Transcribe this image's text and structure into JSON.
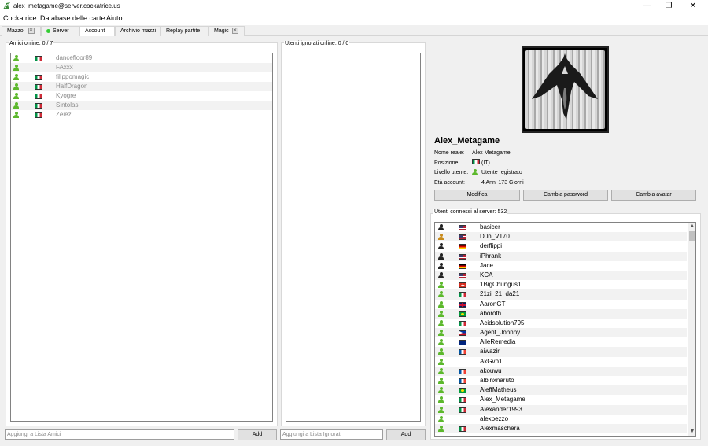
{
  "window": {
    "title": "alex_metagame@server.cockatrice.us",
    "minimize": "—",
    "maximize": "❐",
    "close": "✕"
  },
  "menu": [
    "Cockatrice",
    "Database delle carte",
    "Aiuto"
  ],
  "tabs": [
    {
      "label": "Mazzo:",
      "closable": true
    },
    {
      "label": "Server",
      "status": "online"
    },
    {
      "label": "Account",
      "active": true
    },
    {
      "label": "Archivio mazzi"
    },
    {
      "label": "Replay partite"
    },
    {
      "label": "Magic",
      "closable": true
    }
  ],
  "friends": {
    "header": "Amici online: 0 / 7",
    "items": [
      {
        "name": "dancefloor89",
        "flag": "it"
      },
      {
        "name": "FAxxx",
        "flag": "none"
      },
      {
        "name": "filippomagic",
        "flag": "it"
      },
      {
        "name": "HalfDragon",
        "flag": "it"
      },
      {
        "name": "Kyogre",
        "flag": "it"
      },
      {
        "name": "Sintolas",
        "flag": "it"
      },
      {
        "name": "Zeiez",
        "flag": "it"
      }
    ],
    "add_placeholder": "Aggiungi a Lista Amici",
    "add_button": "Add"
  },
  "ignored": {
    "header": "Utenti ignorati online: 0 / 0",
    "add_placeholder": "Aggiungi a Lista Ignorati",
    "add_button": "Add"
  },
  "profile": {
    "username": "Alex_Metagame",
    "real_name_label": "Nome reale:",
    "real_name": "Alex Metagame",
    "location_label": "Posizione:",
    "location": "(IT)",
    "level_label": "Livello utente:",
    "level": "Utente registrato",
    "age_label": "Età account:",
    "age": "4 Anni 173 Giorni",
    "buttons": {
      "edit": "Modifica",
      "change_password": "Cambia password",
      "change_avatar": "Cambia avatar"
    }
  },
  "online_users": {
    "header": "Utenti connessi al server: 532",
    "items": [
      {
        "name": "basicer",
        "flag": "us",
        "role": "dark"
      },
      {
        "name": "D0n_V170",
        "flag": "us",
        "role": "gold"
      },
      {
        "name": "derflippi",
        "flag": "de",
        "role": "dark"
      },
      {
        "name": "iPhrank",
        "flag": "us",
        "role": "dark"
      },
      {
        "name": "Jace",
        "flag": "de",
        "role": "dark"
      },
      {
        "name": "KCA",
        "flag": "us",
        "role": "dark"
      },
      {
        "name": "1BigChungus1",
        "flag": "ch",
        "role": "green"
      },
      {
        "name": "21zi_21_da21",
        "flag": "it",
        "role": "green"
      },
      {
        "name": "AaronGT",
        "flag": "gb",
        "role": "green"
      },
      {
        "name": "aboroth",
        "flag": "br",
        "role": "green"
      },
      {
        "name": "Acidsolution795",
        "flag": "it",
        "role": "green"
      },
      {
        "name": "Agent_Johnny",
        "flag": "ph",
        "role": "green"
      },
      {
        "name": "AileRemedia",
        "flag": "au",
        "role": "green"
      },
      {
        "name": "aiwazir",
        "flag": "fr",
        "role": "green"
      },
      {
        "name": "AkGvp1",
        "flag": "none",
        "role": "green"
      },
      {
        "name": "akouwu",
        "flag": "fr",
        "role": "green"
      },
      {
        "name": "albinxnaruto",
        "flag": "fr",
        "role": "green"
      },
      {
        "name": "AleffMatheus",
        "flag": "br",
        "role": "green"
      },
      {
        "name": "Alex_Metagame",
        "flag": "it",
        "role": "green"
      },
      {
        "name": "Alexander1993",
        "flag": "it",
        "role": "green"
      },
      {
        "name": "alexbezzo",
        "flag": "none",
        "role": "green"
      },
      {
        "name": "Alexmaschera",
        "flag": "it",
        "role": "green"
      }
    ]
  }
}
